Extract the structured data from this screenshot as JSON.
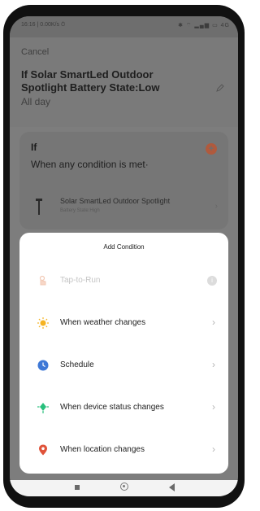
{
  "status_bar": {
    "time": "16:16 | 0.00K/s ⏱",
    "icons": "✱ ⌔ ▂▄▆ ▭ 4G"
  },
  "header": {
    "cancel_label": "Cancel",
    "title": "If Solar SmartLed Outdoor Spotlight Battery State:Low",
    "subtitle": "All day"
  },
  "if_section": {
    "label": "If",
    "description": "When any condition is met·",
    "device": {
      "name": "Solar SmartLed Outdoor Spotlight",
      "state": "Battery State:High"
    }
  },
  "sheet": {
    "title": "Add Condition",
    "options": [
      {
        "label": "Tap-to-Run",
        "icon": "tap-icon",
        "disabled": true
      },
      {
        "label": "When weather changes",
        "icon": "sun-icon"
      },
      {
        "label": "Schedule",
        "icon": "clock-icon"
      },
      {
        "label": "When device status changes",
        "icon": "device-status-icon"
      },
      {
        "label": "When location changes",
        "icon": "location-pin-icon"
      }
    ]
  },
  "colors": {
    "sun": "#f5b323",
    "clock": "#3e78d6",
    "device": "#29c07d",
    "location": "#e0533a",
    "add": "#e86a3a"
  }
}
